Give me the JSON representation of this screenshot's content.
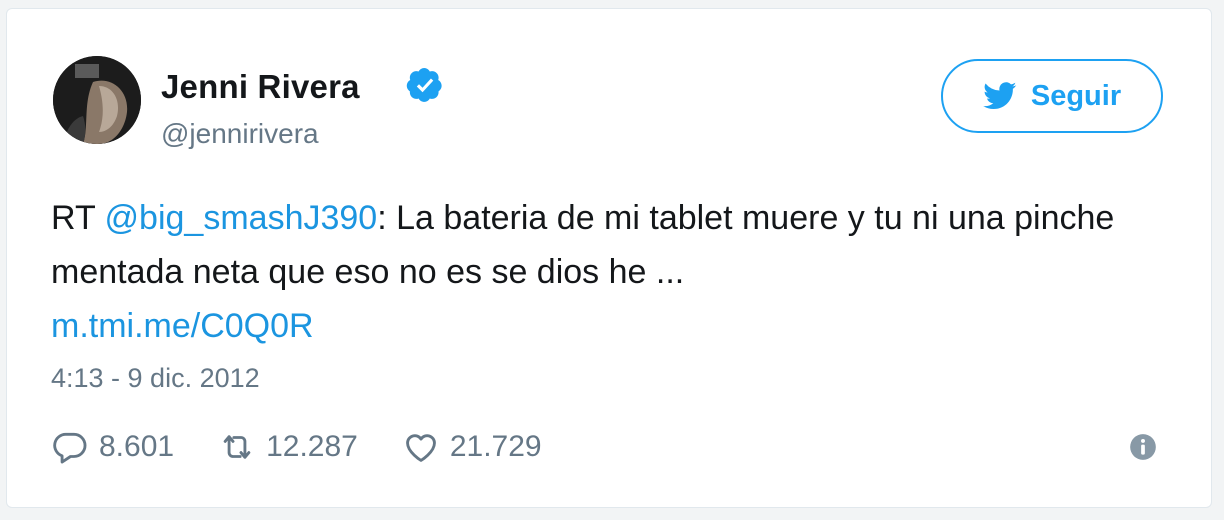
{
  "user": {
    "display_name": "Jenni Rivera",
    "handle": "@jennirivera",
    "verified_icon": "verified-badge-icon"
  },
  "follow_button": {
    "label": "Seguir",
    "icon": "twitter-bird-icon"
  },
  "tweet": {
    "prefix": "RT ",
    "mention": "@big_smashJ390",
    "body": ": La bateria de mi tablet muere y tu ni una pinche mentada neta que eso no es se dios he ...",
    "link": "m.tmi.me/C0Q0R",
    "timestamp": "4:13 - 9 dic. 2012"
  },
  "stats": {
    "replies": "8.601",
    "retweets": "12.287",
    "likes": "21.729"
  },
  "colors": {
    "accent": "#1da1f2",
    "link": "#1b95e0",
    "text": "#14171a",
    "muted": "#657786"
  }
}
